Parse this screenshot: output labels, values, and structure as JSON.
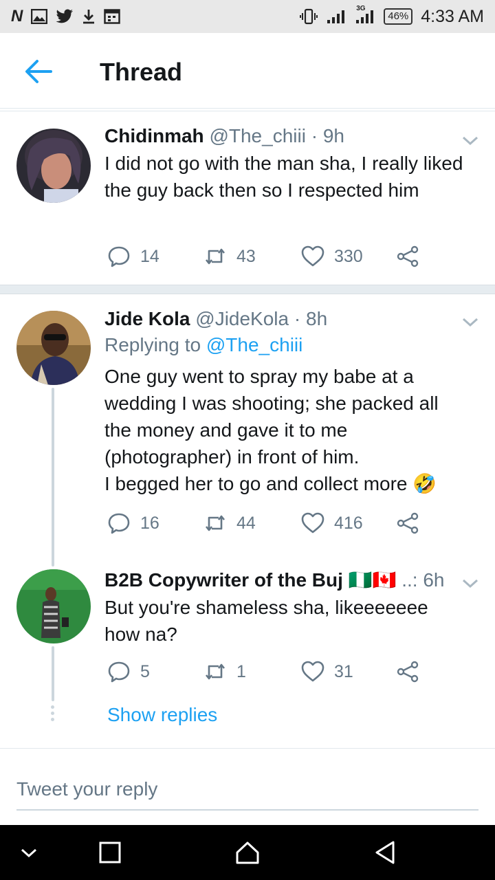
{
  "status_bar": {
    "left_icons": [
      "news-icon",
      "image-icon",
      "twitter-icon",
      "download-icon",
      "calendar-icon"
    ],
    "battery": "46%",
    "network": "3G",
    "time": "4:33 AM"
  },
  "header": {
    "title": "Thread"
  },
  "tweets": [
    {
      "name": "Chidinmah",
      "handle": "@The_chiii",
      "time": "· 9h",
      "text": "I did not go with the man sha, I really liked the guy back then so I respected him",
      "replies": "14",
      "retweets": "43",
      "likes": "330"
    },
    {
      "name": "Jide Kola",
      "handle": "@JideKola",
      "time": "· 8h",
      "replying_prefix": "Replying to",
      "replying_to": "@The_chiii",
      "text": "One guy went to spray my babe at a wedding I was shooting; she packed all the money and gave it to me (photographer) in front of him.",
      "text2": "I begged her to go and collect more 🤣",
      "replies": "16",
      "retweets": "44",
      "likes": "416"
    },
    {
      "name": "B2B Copywriter of the Buj",
      "flags": "🇳🇬🇨🇦",
      "handle": "..:",
      "time": "6h",
      "text": "But you're shameless sha, likeeeeeee how na?",
      "replies": "5",
      "retweets": "1",
      "likes": "31"
    }
  ],
  "show_replies": "Show replies",
  "reply_box": {
    "placeholder": "Tweet your reply"
  },
  "colors": {
    "accent": "#1da1f2",
    "muted": "#657786",
    "text": "#14171a",
    "divider": "#e6ecf0"
  }
}
